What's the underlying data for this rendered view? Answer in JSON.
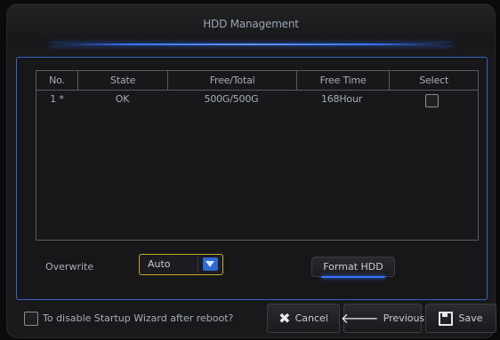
{
  "dialog": {
    "title": "HDD Management"
  },
  "table": {
    "columns": [
      "No.",
      "State",
      "Free/Total",
      "Free Time",
      "Select"
    ],
    "rows": [
      {
        "no": "1 *",
        "state": "OK",
        "free_total": "500G/500G",
        "free_time": "168Hour",
        "selected": false
      }
    ]
  },
  "overwrite": {
    "label": "Overwrite",
    "value": "Auto"
  },
  "format_button": {
    "label": "Format HDD"
  },
  "footer": {
    "startup_wizard_label": "To disable Startup Wizard after reboot?",
    "startup_wizard_checked": false,
    "cancel_label": "Cancel",
    "previous_label": "Previous",
    "save_label": "Save"
  },
  "colors": {
    "accent_blue": "#3a74ff",
    "focus_yellow": "#c6a72b",
    "text": "#a7adb6"
  },
  "icons": {
    "cancel": "x-icon",
    "previous": "arrow-left-icon",
    "save": "floppy-icon",
    "dropdown": "chevron-down-icon"
  }
}
